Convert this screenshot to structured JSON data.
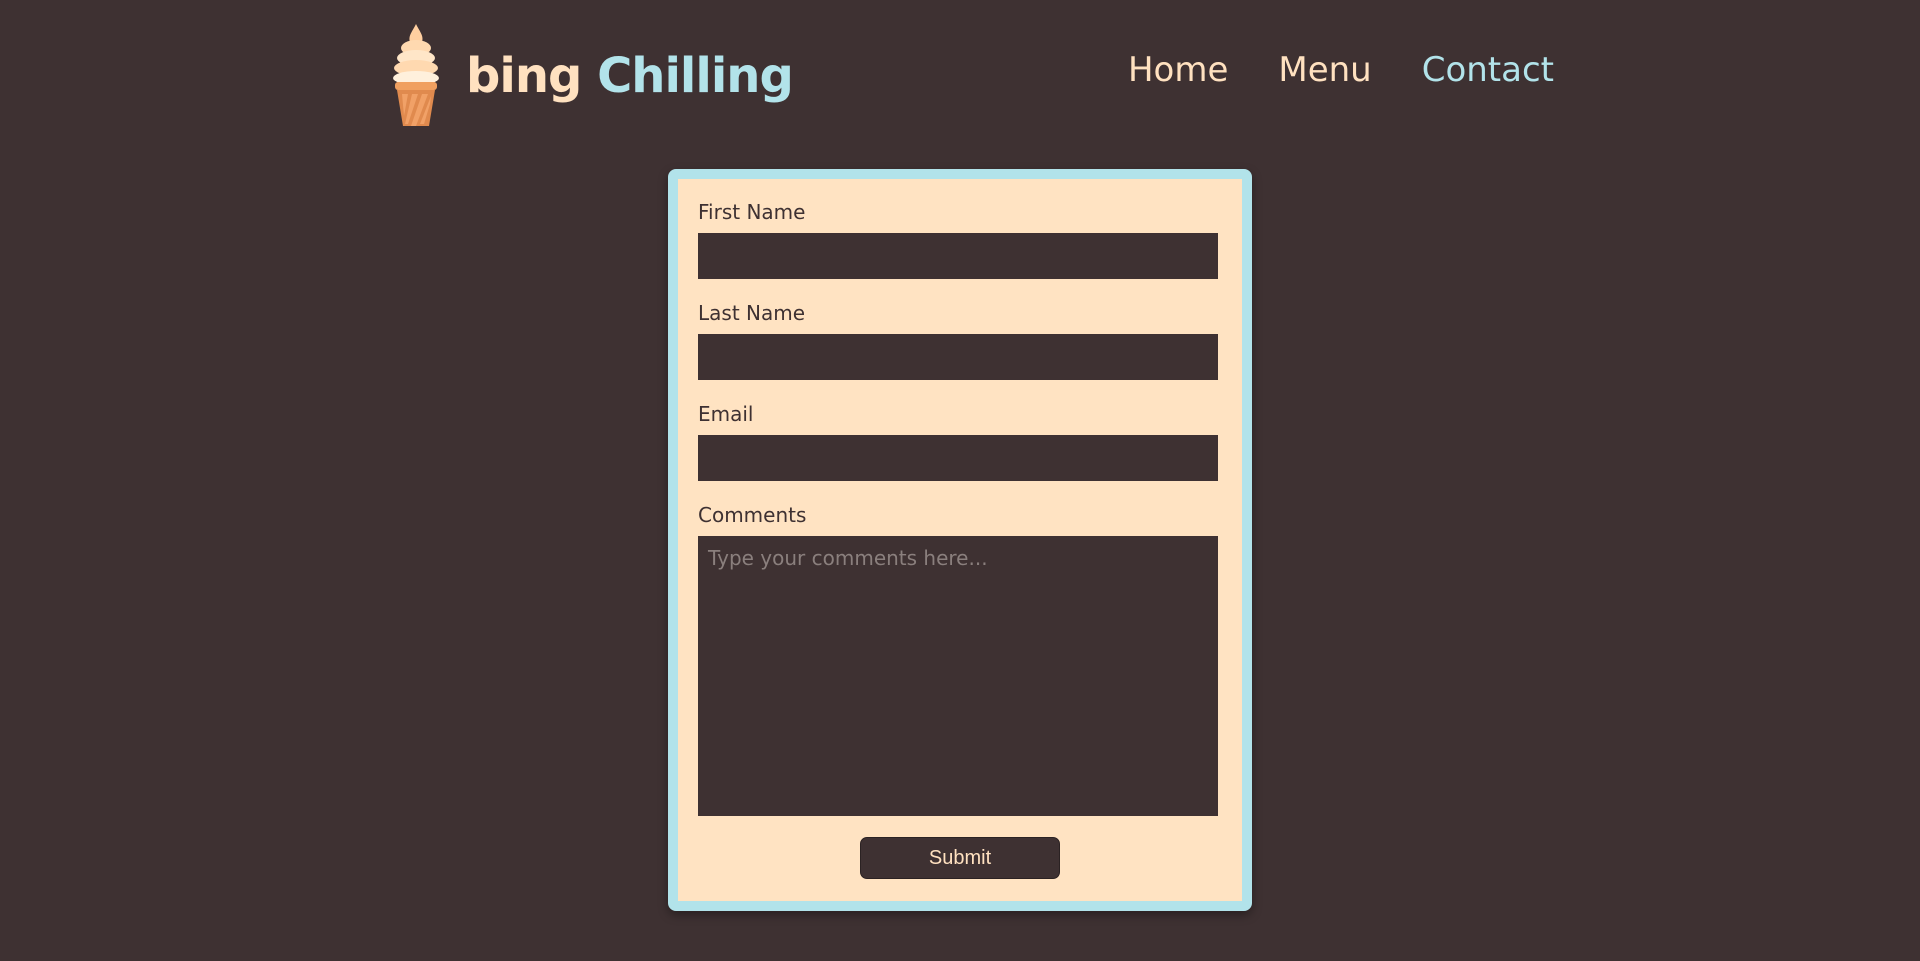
{
  "brand": {
    "word1": "bing",
    "word2": "Chilling",
    "logo_icon": "ice-cream-cone-icon"
  },
  "nav": {
    "items": [
      {
        "label": "Home"
      },
      {
        "label": "Menu"
      },
      {
        "label": "Contact",
        "active": true
      }
    ]
  },
  "form": {
    "first_name": {
      "label": "First Name",
      "value": ""
    },
    "last_name": {
      "label": "Last Name",
      "value": ""
    },
    "email": {
      "label": "Email",
      "value": ""
    },
    "comments": {
      "label": "Comments",
      "placeholder": "Type your comments here...",
      "value": ""
    },
    "submit_label": "Submit"
  },
  "colors": {
    "background": "#3e3132",
    "cream": "#ffe1c0",
    "accent_blue": "#b2e3ea",
    "card": "#ffe3c2"
  }
}
